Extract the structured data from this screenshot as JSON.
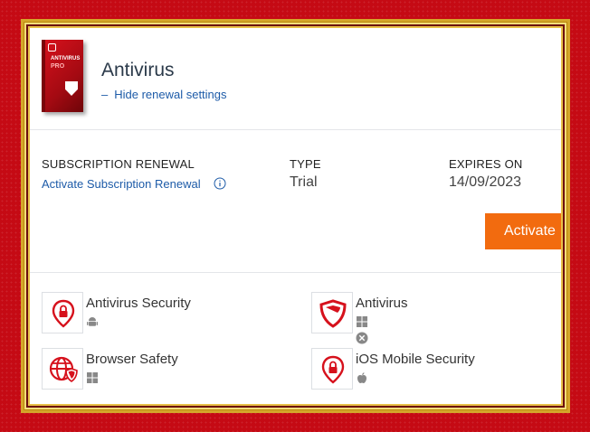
{
  "product": {
    "box_text_line1": "ANTIVIRUS",
    "box_text_line2": "PRO",
    "title": "Antivirus",
    "hide_link_prefix": "–",
    "hide_link_label": "Hide renewal settings"
  },
  "subscription": {
    "renewal_header": "SUBSCRIPTION RENEWAL",
    "renewal_link": "Activate Subscription Renewal",
    "type_header": "TYPE",
    "type_value": "Trial",
    "expires_header": "EXPIRES ON",
    "expires_value": "14/09/2023"
  },
  "actions": {
    "activate_label": "Activate"
  },
  "colors": {
    "accent": "#f26b0f",
    "brand_red": "#d6111c",
    "link": "#1d5ba8"
  },
  "features": [
    {
      "name": "Antivirus Security",
      "icon": "location-lock-icon",
      "platforms": [
        "android-icon"
      ]
    },
    {
      "name": "Antivirus",
      "icon": "shield-icon",
      "platforms": [
        "windows-icon",
        "macos-icon"
      ]
    },
    {
      "name": "Browser Safety",
      "icon": "globe-shield-icon",
      "platforms": [
        "windows-icon"
      ]
    },
    {
      "name": "iOS Mobile Security",
      "icon": "location-lock-icon",
      "platforms": [
        "apple-icon"
      ]
    }
  ]
}
